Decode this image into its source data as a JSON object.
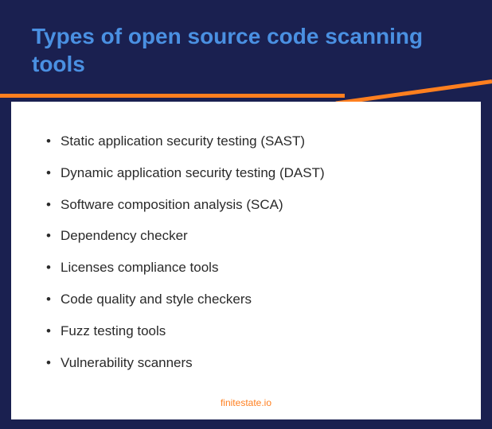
{
  "title": "Types of open source code scanning tools",
  "items": [
    "Static application security testing (SAST)",
    "Dynamic application security testing (DAST)",
    "Software composition analysis (SCA)",
    "Dependency checker",
    "Licenses compliance tools",
    "Code quality and style checkers",
    "Fuzz testing tools",
    "Vulnerability scanners"
  ],
  "footer": "finitestate.io"
}
